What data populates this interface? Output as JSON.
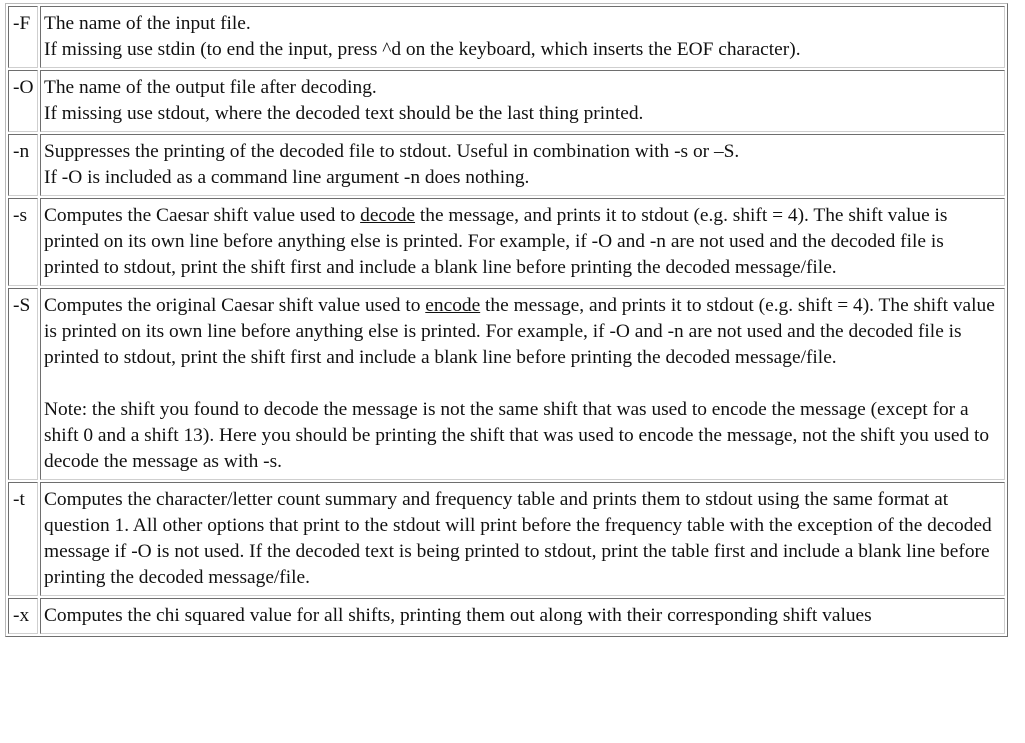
{
  "options": [
    {
      "flag": "-F",
      "lines": [
        "The name of the input file.",
        "If missing use stdin (to end the input, press ^d on the keyboard, which inserts the EOF character)."
      ]
    },
    {
      "flag": "-O",
      "lines": [
        "The name of the output file after decoding.",
        "If missing use stdout, where the decoded text should be the last thing printed."
      ]
    },
    {
      "flag": "-n",
      "lines": [
        "Suppresses the printing of the decoded file to stdout. Useful in combination with -s or –S.",
        "If -O is included as a command line argument -n does nothing."
      ]
    },
    {
      "flag": "-s",
      "pre": "Computes the Caesar shift value used to ",
      "underlined": "decode",
      "post": " the message, and prints it to stdout (e.g. shift = 4). The shift value is printed on its own line before anything else is printed. For example, if -O and -n are not used and the decoded file is printed to stdout, print the shift first and include a blank line before printing the decoded message/file."
    },
    {
      "flag": "-S",
      "pre": "Computes the original Caesar shift value used to ",
      "underlined": "encode",
      "post": " the message, and prints it to stdout (e.g. shift = 4). The shift value is printed on its own line before anything else is printed. For example, if -O and -n are not used and the decoded file is printed to stdout, print the shift first and include a blank line before printing the decoded message/file.",
      "note": "Note: the shift you found to decode the message is not the same shift that was used to encode the message (except for a shift 0 and a shift 13). Here you should be printing the shift that was used to encode the message, not the shift you used to decode the message as with -s."
    },
    {
      "flag": "-t",
      "text": "Computes the character/letter count summary and frequency table and prints them to stdout using the same format at question 1. All other options that print to the stdout will print before the frequency table with the exception of the decoded message if -O is not used. If the decoded text is being printed to stdout, print the table first and include a blank line before printing the decoded message/file."
    },
    {
      "flag": "-x",
      "text": "Computes the chi squared value for all shifts, printing them out along with their corresponding shift values"
    }
  ]
}
